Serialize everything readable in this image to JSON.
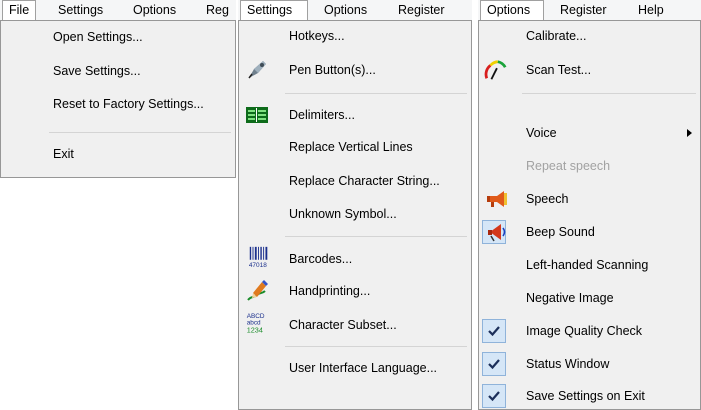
{
  "file_panel": {
    "menubar": [
      "File",
      "Settings",
      "Options",
      "Reg"
    ],
    "items": [
      "Open Settings...",
      "Save Settings...",
      "Reset to Factory Settings...",
      "Exit"
    ]
  },
  "settings_panel": {
    "menubar": [
      "Settings",
      "Options",
      "Register"
    ],
    "items": [
      "Hotkeys...",
      "Pen Button(s)...",
      "Delimiters...",
      "Replace Vertical Lines",
      "Replace Character String...",
      "Unknown Symbol...",
      "Barcodes...",
      "Handprinting...",
      "Character Subset...",
      "User Interface Language..."
    ],
    "barcode_icon_text": "47018",
    "subset_icon_text": [
      "ABCD",
      "abcd",
      "1234"
    ]
  },
  "options_panel": {
    "menubar": [
      "Options",
      "Register",
      "Help"
    ],
    "items": [
      "Calibrate...",
      "Scan Test...",
      "Voice",
      "Repeat speech",
      "Speech",
      "Beep Sound",
      "Left-handed Scanning",
      "Negative Image",
      "Image Quality Check",
      "Status Window",
      "Save Settings on Exit"
    ]
  },
  "colors": {
    "accent": "#3399ff",
    "check_bg": "#d5e6f7",
    "disabled": "#a2a2a2"
  }
}
